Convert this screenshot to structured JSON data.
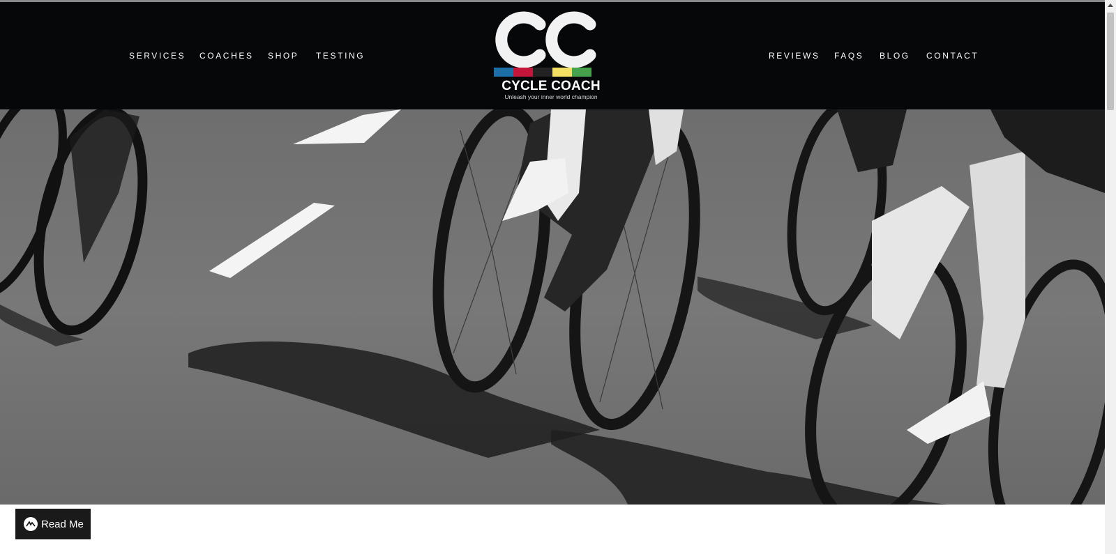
{
  "nav": {
    "left": [
      "SERVICES",
      "COACHES",
      "SHOP",
      "TESTING"
    ],
    "right": [
      "REVIEWS",
      "FAQS",
      "BLOG",
      "CONTACT"
    ]
  },
  "logo": {
    "title": "CYCLE COACH",
    "tagline": "Unleash your inner world champion",
    "stripe_colors": [
      "#1d6fa8",
      "#c4163b",
      "#222222",
      "#f2df63",
      "#46a24c"
    ]
  },
  "hero": {
    "description_icon": "cyclists-road-photo"
  },
  "read_me": {
    "label": "Read Me"
  }
}
